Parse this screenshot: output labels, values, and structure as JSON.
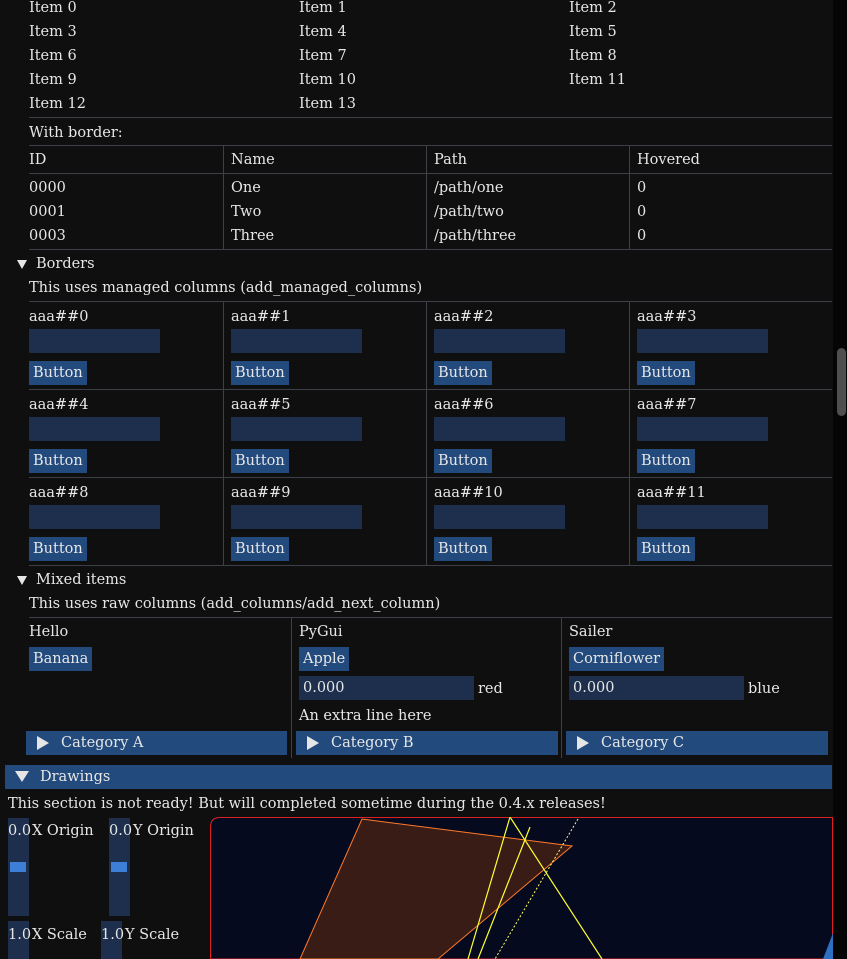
{
  "grid_items": [
    "Item 0",
    "Item 1",
    "Item 2",
    "Item 3",
    "Item 4",
    "Item 5",
    "Item 6",
    "Item 7",
    "Item 8",
    "Item 9",
    "Item 10",
    "Item 11",
    "Item 12",
    "Item 13"
  ],
  "with_border": {
    "label": "With border:",
    "headers": [
      "ID",
      "Name",
      "Path",
      "Hovered"
    ],
    "rows": [
      [
        "0000",
        "One",
        "/path/one",
        "0"
      ],
      [
        "0001",
        "Two",
        "/path/two",
        "0"
      ],
      [
        "0003",
        "Three",
        "/path/three",
        "0"
      ]
    ]
  },
  "borders": {
    "title": "Borders",
    "description": "This uses managed columns (add_managed_columns)",
    "cells": [
      "aaa##0",
      "aaa##1",
      "aaa##2",
      "aaa##3",
      "aaa##4",
      "aaa##5",
      "aaa##6",
      "aaa##7",
      "aaa##8",
      "aaa##9",
      "aaa##10",
      "aaa##11"
    ],
    "button_label": "Button"
  },
  "mixed": {
    "title": "Mixed items",
    "description": "This uses raw columns (add_columns/add_next_column)",
    "col1": {
      "header": "Hello",
      "button": "Banana",
      "category": "Category A"
    },
    "col2": {
      "header": "PyGui",
      "button": "Apple",
      "input_value": "0.000",
      "input_label": "red",
      "extra": "An extra line here",
      "category": "Category B"
    },
    "col3": {
      "header": "Sailer",
      "button": "Corniflower",
      "input_value": "0.000",
      "input_label": "blue",
      "category": "Category C"
    }
  },
  "drawings": {
    "title": "Drawings",
    "notice": "This section is not ready! But will completed sometime during the 0.4.x releases!",
    "x_origin": {
      "value": "0.0",
      "label": "X Origin"
    },
    "y_origin": {
      "value": "0.0",
      "label": "Y Origin"
    },
    "x_scale": {
      "value": "1.0",
      "label": "X Scale"
    },
    "y_scale": {
      "value": "1.0",
      "label": "Y Scale"
    }
  },
  "colors": {
    "accent": "#234a7c",
    "frame": "#1d2f4c",
    "canvas": "#050a1f",
    "canvas_border": "#e02020"
  }
}
